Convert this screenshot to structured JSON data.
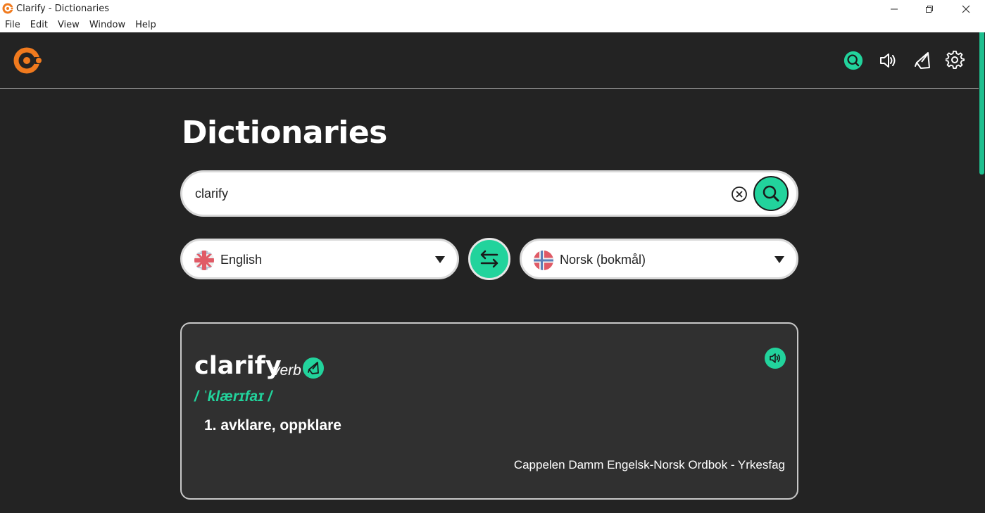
{
  "window": {
    "title": "Clarify - Dictionaries"
  },
  "menu": [
    "File",
    "Edit",
    "View",
    "Window",
    "Help"
  ],
  "header": {
    "icons": [
      "search-icon",
      "speaker-icon",
      "pen-icon",
      "gear-icon"
    ]
  },
  "page": {
    "title": "Dictionaries"
  },
  "search": {
    "value": "clarify",
    "placeholder": ""
  },
  "languages": {
    "source": "English",
    "target": "Norsk (bokmål)"
  },
  "result": {
    "word": "clarify",
    "part_of_speech": "verb",
    "phonetic": "/ ˈklærɪfaɪ /",
    "definition": "1. avklare, oppklare",
    "source": "Cappelen Damm Engelsk-Norsk Ordbok - Yrkesfag"
  },
  "colors": {
    "accent": "#22d39c",
    "brand": "#f07a1e",
    "background": "#232323",
    "card": "#303030"
  }
}
